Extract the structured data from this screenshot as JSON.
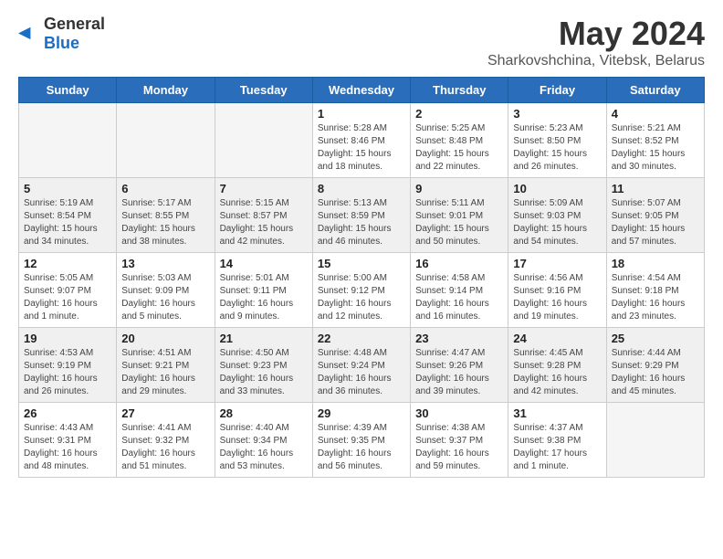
{
  "header": {
    "logo_general": "General",
    "logo_blue": "Blue",
    "month_year": "May 2024",
    "location": "Sharkovshchina, Vitebsk, Belarus"
  },
  "weekdays": [
    "Sunday",
    "Monday",
    "Tuesday",
    "Wednesday",
    "Thursday",
    "Friday",
    "Saturday"
  ],
  "weeks": [
    [
      {
        "day": "",
        "info": ""
      },
      {
        "day": "",
        "info": ""
      },
      {
        "day": "",
        "info": ""
      },
      {
        "day": "1",
        "info": "Sunrise: 5:28 AM\nSunset: 8:46 PM\nDaylight: 15 hours\nand 18 minutes."
      },
      {
        "day": "2",
        "info": "Sunrise: 5:25 AM\nSunset: 8:48 PM\nDaylight: 15 hours\nand 22 minutes."
      },
      {
        "day": "3",
        "info": "Sunrise: 5:23 AM\nSunset: 8:50 PM\nDaylight: 15 hours\nand 26 minutes."
      },
      {
        "day": "4",
        "info": "Sunrise: 5:21 AM\nSunset: 8:52 PM\nDaylight: 15 hours\nand 30 minutes."
      }
    ],
    [
      {
        "day": "5",
        "info": "Sunrise: 5:19 AM\nSunset: 8:54 PM\nDaylight: 15 hours\nand 34 minutes."
      },
      {
        "day": "6",
        "info": "Sunrise: 5:17 AM\nSunset: 8:55 PM\nDaylight: 15 hours\nand 38 minutes."
      },
      {
        "day": "7",
        "info": "Sunrise: 5:15 AM\nSunset: 8:57 PM\nDaylight: 15 hours\nand 42 minutes."
      },
      {
        "day": "8",
        "info": "Sunrise: 5:13 AM\nSunset: 8:59 PM\nDaylight: 15 hours\nand 46 minutes."
      },
      {
        "day": "9",
        "info": "Sunrise: 5:11 AM\nSunset: 9:01 PM\nDaylight: 15 hours\nand 50 minutes."
      },
      {
        "day": "10",
        "info": "Sunrise: 5:09 AM\nSunset: 9:03 PM\nDaylight: 15 hours\nand 54 minutes."
      },
      {
        "day": "11",
        "info": "Sunrise: 5:07 AM\nSunset: 9:05 PM\nDaylight: 15 hours\nand 57 minutes."
      }
    ],
    [
      {
        "day": "12",
        "info": "Sunrise: 5:05 AM\nSunset: 9:07 PM\nDaylight: 16 hours\nand 1 minute."
      },
      {
        "day": "13",
        "info": "Sunrise: 5:03 AM\nSunset: 9:09 PM\nDaylight: 16 hours\nand 5 minutes."
      },
      {
        "day": "14",
        "info": "Sunrise: 5:01 AM\nSunset: 9:11 PM\nDaylight: 16 hours\nand 9 minutes."
      },
      {
        "day": "15",
        "info": "Sunrise: 5:00 AM\nSunset: 9:12 PM\nDaylight: 16 hours\nand 12 minutes."
      },
      {
        "day": "16",
        "info": "Sunrise: 4:58 AM\nSunset: 9:14 PM\nDaylight: 16 hours\nand 16 minutes."
      },
      {
        "day": "17",
        "info": "Sunrise: 4:56 AM\nSunset: 9:16 PM\nDaylight: 16 hours\nand 19 minutes."
      },
      {
        "day": "18",
        "info": "Sunrise: 4:54 AM\nSunset: 9:18 PM\nDaylight: 16 hours\nand 23 minutes."
      }
    ],
    [
      {
        "day": "19",
        "info": "Sunrise: 4:53 AM\nSunset: 9:19 PM\nDaylight: 16 hours\nand 26 minutes."
      },
      {
        "day": "20",
        "info": "Sunrise: 4:51 AM\nSunset: 9:21 PM\nDaylight: 16 hours\nand 29 minutes."
      },
      {
        "day": "21",
        "info": "Sunrise: 4:50 AM\nSunset: 9:23 PM\nDaylight: 16 hours\nand 33 minutes."
      },
      {
        "day": "22",
        "info": "Sunrise: 4:48 AM\nSunset: 9:24 PM\nDaylight: 16 hours\nand 36 minutes."
      },
      {
        "day": "23",
        "info": "Sunrise: 4:47 AM\nSunset: 9:26 PM\nDaylight: 16 hours\nand 39 minutes."
      },
      {
        "day": "24",
        "info": "Sunrise: 4:45 AM\nSunset: 9:28 PM\nDaylight: 16 hours\nand 42 minutes."
      },
      {
        "day": "25",
        "info": "Sunrise: 4:44 AM\nSunset: 9:29 PM\nDaylight: 16 hours\nand 45 minutes."
      }
    ],
    [
      {
        "day": "26",
        "info": "Sunrise: 4:43 AM\nSunset: 9:31 PM\nDaylight: 16 hours\nand 48 minutes."
      },
      {
        "day": "27",
        "info": "Sunrise: 4:41 AM\nSunset: 9:32 PM\nDaylight: 16 hours\nand 51 minutes."
      },
      {
        "day": "28",
        "info": "Sunrise: 4:40 AM\nSunset: 9:34 PM\nDaylight: 16 hours\nand 53 minutes."
      },
      {
        "day": "29",
        "info": "Sunrise: 4:39 AM\nSunset: 9:35 PM\nDaylight: 16 hours\nand 56 minutes."
      },
      {
        "day": "30",
        "info": "Sunrise: 4:38 AM\nSunset: 9:37 PM\nDaylight: 16 hours\nand 59 minutes."
      },
      {
        "day": "31",
        "info": "Sunrise: 4:37 AM\nSunset: 9:38 PM\nDaylight: 17 hours\nand 1 minute."
      },
      {
        "day": "",
        "info": ""
      }
    ]
  ]
}
